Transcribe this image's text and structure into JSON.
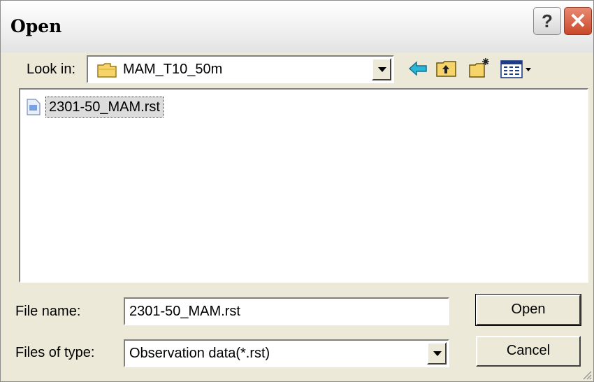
{
  "dialog": {
    "title": "Open"
  },
  "title_buttons": {
    "help": "?",
    "close": "✕"
  },
  "lookin": {
    "label": "Look in:",
    "value": "MAM_T10_50m"
  },
  "toolbar": {
    "icons": [
      "back-icon",
      "up-folder-icon",
      "new-folder-icon",
      "view-menu-icon"
    ]
  },
  "files": [
    {
      "name": "2301-50_MAM.rst",
      "selected": true
    }
  ],
  "filename": {
    "label": "File name:",
    "value": "2301-50_MAM.rst"
  },
  "filetype": {
    "label": "Files of type:",
    "value": "Observation data(*.rst)"
  },
  "buttons": {
    "open": "Open",
    "cancel": "Cancel"
  },
  "colors": {
    "dialog_bg": "#ece9d8",
    "close_red": "#c9482a",
    "selection": "#dcdcdc"
  }
}
